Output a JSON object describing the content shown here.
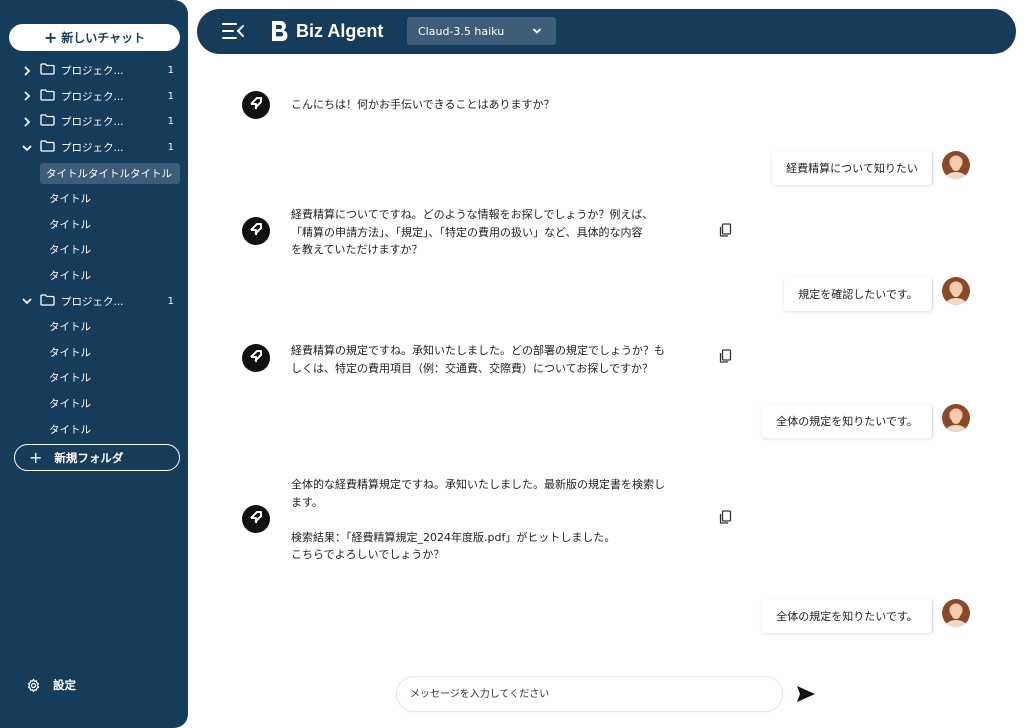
{
  "app": {
    "name": "Biz Algent"
  },
  "sidebar": {
    "new_chat_label": "新しいチャット",
    "new_folder_label": "新規フォルダ",
    "settings_label": "設定",
    "tree": [
      {
        "type": "folder",
        "label": "プロジェク...",
        "count": "1",
        "expanded": false
      },
      {
        "type": "folder",
        "label": "プロジェク...",
        "count": "1",
        "expanded": false
      },
      {
        "type": "folder",
        "label": "プロジェク...",
        "count": "1",
        "expanded": false
      },
      {
        "type": "folder",
        "label": "プロジェク...",
        "count": "1",
        "expanded": true
      },
      {
        "type": "child",
        "label": "タイトルタイトルタイトル",
        "selected": true
      },
      {
        "type": "child",
        "label": "タイトル"
      },
      {
        "type": "child",
        "label": "タイトル"
      },
      {
        "type": "child",
        "label": "タイトル"
      },
      {
        "type": "child",
        "label": "タイトル"
      },
      {
        "type": "folder",
        "label": "プロジェク...",
        "count": "1",
        "expanded": true
      },
      {
        "type": "child",
        "label": "タイトル"
      },
      {
        "type": "child",
        "label": "タイトル"
      },
      {
        "type": "child",
        "label": "タイトル"
      },
      {
        "type": "child",
        "label": "タイトル"
      },
      {
        "type": "child",
        "label": "タイトル"
      }
    ]
  },
  "header": {
    "model": "Claud-3.5 haiku"
  },
  "chat": {
    "messages": [
      {
        "role": "bot",
        "lines": [
          "こんにちは！何かお手伝いできることはありますか？"
        ]
      },
      {
        "role": "user",
        "text": "経費精算について知りたい"
      },
      {
        "role": "bot",
        "lines": [
          "経費精算についてですね。どのような情報をお探しでしょうか？例えば、",
          "「精算の申請方法」、「規定」、「特定の費用の扱い」など、具体的な内容",
          "を教えていただけますか？"
        ]
      },
      {
        "role": "user",
        "text": "規定を確認したいです。"
      },
      {
        "role": "bot",
        "lines": [
          "経費精算の規定ですね。承知いたしました。どの部署の規定でしょうか？も",
          "しくは、特定の費用項目（例：交通費、交際費）についてお探しですか？"
        ]
      },
      {
        "role": "user",
        "text": "全体の規定を知りたいです。"
      },
      {
        "role": "bot",
        "lines": [
          "全体的な経費精算規定ですね。承知いたしました。最新版の規定書を検索し",
          "ます。",
          "",
          "検索結果：「経費精算規定_2024年度版.pdf」がヒットしました。",
          "こちらでよろしいでしょうか？"
        ]
      },
      {
        "role": "user",
        "text": "全体の規定を知りたいです。"
      }
    ]
  },
  "input": {
    "placeholder": "メッセージを入力してください"
  },
  "colors": {
    "sidebar_bg": "#163c5c",
    "header_bg": "#163c5c",
    "select_bg": "#3d5d78"
  }
}
